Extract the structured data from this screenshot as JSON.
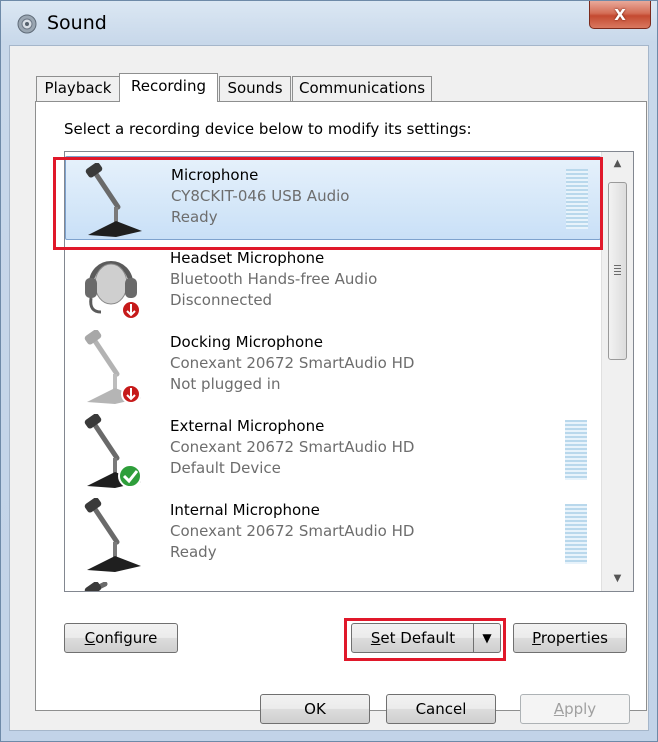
{
  "window": {
    "title": "Sound",
    "close_label": "X",
    "accent_highlight": "#e0182a"
  },
  "tabs": [
    {
      "label": "Playback",
      "active": false
    },
    {
      "label": "Recording",
      "active": true
    },
    {
      "label": "Sounds",
      "active": false
    },
    {
      "label": "Communications",
      "active": false
    }
  ],
  "instruction": "Select a recording device below to modify its settings:",
  "devices": [
    {
      "name": "Microphone",
      "driver": "CY8CKIT-046 USB Audio",
      "status": "Ready",
      "icon": "microphone-icon",
      "selected": true,
      "meter": true
    },
    {
      "name": "Headset Microphone",
      "driver": "Bluetooth Hands-free Audio",
      "status": "Disconnected",
      "icon": "headset-icon",
      "badge": "down-arrow-badge",
      "meter": false
    },
    {
      "name": "Docking Microphone",
      "driver": "Conexant 20672 SmartAudio HD",
      "status": "Not plugged in",
      "icon": "microphone-icon",
      "badge": "down-arrow-badge",
      "meter": false
    },
    {
      "name": "External Microphone",
      "driver": "Conexant 20672 SmartAudio HD",
      "status": "Default Device",
      "icon": "microphone-icon",
      "badge": "checkmark-badge",
      "meter": true
    },
    {
      "name": "Internal Microphone",
      "driver": "Conexant 20672 SmartAudio HD",
      "status": "Ready",
      "icon": "microphone-icon",
      "meter": true
    }
  ],
  "buttons": {
    "configure": {
      "prefix": "",
      "mnemonic": "C",
      "rest": "onfigure"
    },
    "set_default": {
      "prefix": "",
      "mnemonic": "S",
      "rest": "et Default"
    },
    "properties": {
      "prefix": "",
      "mnemonic": "P",
      "rest": "roperties"
    },
    "ok": "OK",
    "cancel": "Cancel",
    "apply": {
      "prefix": "",
      "mnemonic": "A",
      "rest": "pply"
    }
  }
}
